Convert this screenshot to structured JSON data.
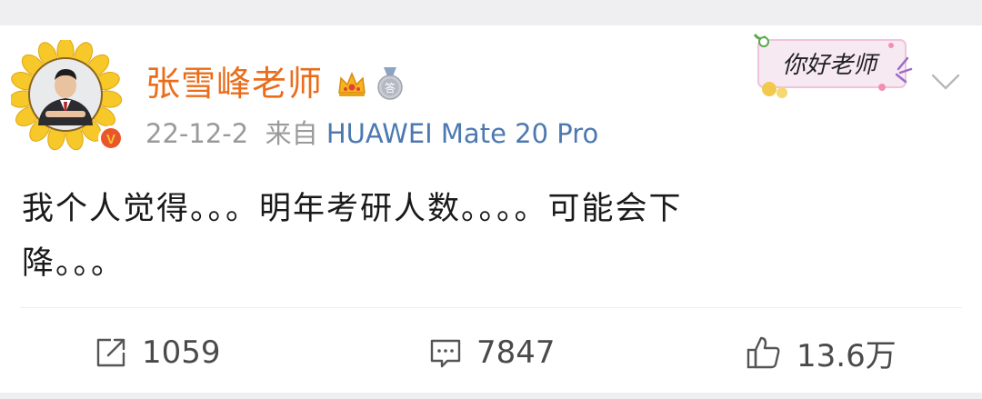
{
  "post": {
    "author": {
      "name": "张雪峰老师",
      "verified_badge": "V",
      "badges": [
        "crown-icon",
        "answer-medal-icon"
      ],
      "medal_label": "答"
    },
    "date": "22-12-2",
    "source_prefix": "来自",
    "source_device": "HUAWEI Mate 20 Pro",
    "sticker_text": "你好老师",
    "text_line1": "我个人觉得。。。明年考研人数。。。。可能会下",
    "text_line2": "降。。。"
  },
  "actions": {
    "repost": {
      "icon": "repost-icon",
      "count": "1059"
    },
    "comment": {
      "icon": "comment-icon",
      "count": "7847"
    },
    "like": {
      "icon": "thumbs-up-icon",
      "count": "13.6万"
    }
  },
  "colors": {
    "username": "#ea6d1b",
    "source": "#4d79b0",
    "meta": "#9a9a9a",
    "band": "#efeff1",
    "verified": "#e8562a"
  }
}
